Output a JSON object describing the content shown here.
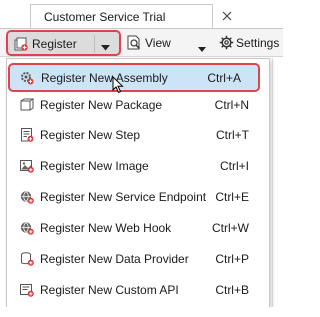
{
  "window": {
    "tab_title": "Customer Service Trial"
  },
  "toolbar": {
    "register_label": "Register",
    "view_label": "View",
    "settings_label": "Settings"
  },
  "menu": {
    "items": [
      {
        "label": "Register New Assembly",
        "shortcut": "Ctrl+A",
        "icon": "assembly-icon"
      },
      {
        "label": "Register New Package",
        "shortcut": "Ctrl+N",
        "icon": "package-icon"
      },
      {
        "label": "Register New Step",
        "shortcut": "Ctrl+T",
        "icon": "step-icon"
      },
      {
        "label": "Register New Image",
        "shortcut": "Ctrl+I",
        "icon": "image-icon"
      },
      {
        "label": "Register New Service Endpoint",
        "shortcut": "Ctrl+E",
        "icon": "service-endpoint-icon"
      },
      {
        "label": "Register New Web Hook",
        "shortcut": "Ctrl+W",
        "icon": "web-hook-icon"
      },
      {
        "label": "Register New Data Provider",
        "shortcut": "Ctrl+P",
        "icon": "data-provider-icon"
      },
      {
        "label": "Register New Custom API",
        "shortcut": "Ctrl+B",
        "icon": "custom-api-icon"
      }
    ]
  },
  "colors": {
    "highlight_outline": "#e0434d",
    "selected_item_bg": "#cde4f7"
  }
}
